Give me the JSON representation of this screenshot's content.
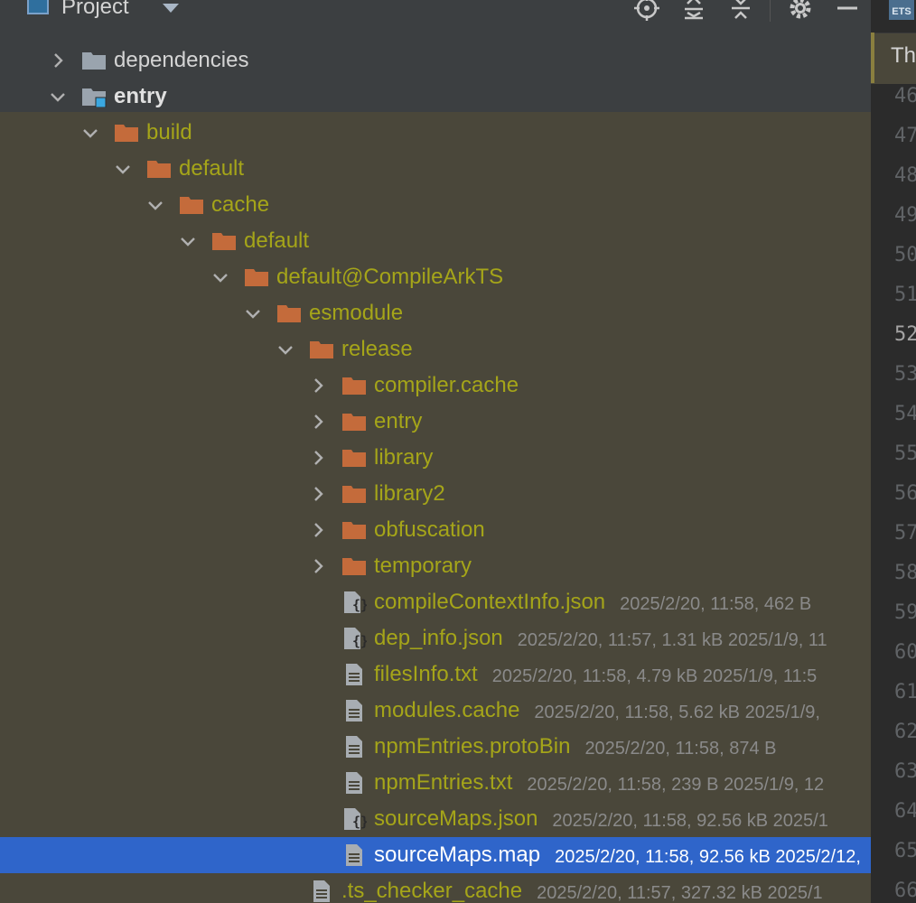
{
  "toolbar": {
    "title": "Project",
    "icons": [
      "locate-icon",
      "expand-all-icon",
      "collapse-all-icon",
      "gear-icon",
      "hide-icon"
    ]
  },
  "tree": {
    "rows": [
      {
        "name": "dependencies",
        "kind": "folder-gray",
        "arrow": "right",
        "meta": "",
        "style": "plain"
      },
      {
        "name": "entry",
        "kind": "module",
        "arrow": "down",
        "meta": "",
        "style": "bold"
      },
      {
        "name": "build",
        "kind": "folder",
        "arrow": "down",
        "meta": ""
      },
      {
        "name": "default",
        "kind": "folder",
        "arrow": "down",
        "meta": ""
      },
      {
        "name": "cache",
        "kind": "folder",
        "arrow": "down",
        "meta": ""
      },
      {
        "name": "default",
        "kind": "folder",
        "arrow": "down",
        "meta": ""
      },
      {
        "name": "default@CompileArkTS",
        "kind": "folder",
        "arrow": "down",
        "meta": ""
      },
      {
        "name": "esmodule",
        "kind": "folder",
        "arrow": "down",
        "meta": ""
      },
      {
        "name": "release",
        "kind": "folder",
        "arrow": "down",
        "meta": ""
      },
      {
        "name": "compiler.cache",
        "kind": "folder",
        "arrow": "right",
        "meta": ""
      },
      {
        "name": "entry",
        "kind": "folder",
        "arrow": "right",
        "meta": ""
      },
      {
        "name": "library",
        "kind": "folder",
        "arrow": "right",
        "meta": ""
      },
      {
        "name": "library2",
        "kind": "folder",
        "arrow": "right",
        "meta": ""
      },
      {
        "name": "obfuscation",
        "kind": "folder",
        "arrow": "right",
        "meta": ""
      },
      {
        "name": "temporary",
        "kind": "folder",
        "arrow": "right",
        "meta": ""
      },
      {
        "name": "compileContextInfo.json",
        "kind": "json",
        "arrow": "",
        "meta": "2025/2/20, 11:58, 462 B"
      },
      {
        "name": "dep_info.json",
        "kind": "json",
        "arrow": "",
        "meta": "2025/2/20, 11:57, 1.31 kB 2025/1/9, 11"
      },
      {
        "name": "filesInfo.txt",
        "kind": "file",
        "arrow": "",
        "meta": "2025/2/20, 11:58, 4.79 kB 2025/1/9, 11:5"
      },
      {
        "name": "modules.cache",
        "kind": "file",
        "arrow": "",
        "meta": "2025/2/20, 11:58, 5.62 kB 2025/1/9,"
      },
      {
        "name": "npmEntries.protoBin",
        "kind": "file",
        "arrow": "",
        "meta": "2025/2/20, 11:58, 874 B"
      },
      {
        "name": "npmEntries.txt",
        "kind": "file",
        "arrow": "",
        "meta": "2025/2/20, 11:58, 239 B 2025/1/9, 12"
      },
      {
        "name": "sourceMaps.json",
        "kind": "json",
        "arrow": "",
        "meta": "2025/2/20, 11:58, 92.56 kB 2025/1"
      },
      {
        "name": "sourceMaps.map",
        "kind": "file",
        "arrow": "",
        "meta": "2025/2/20, 11:58, 92.56 kB 2025/2/12,",
        "selected": true
      },
      {
        "name": ".ts_checker_cache",
        "kind": "file",
        "arrow": "",
        "meta": "2025/2/20, 11:57, 327.32 kB 2025/1"
      }
    ]
  },
  "editor": {
    "tab_badge": "ETS",
    "tab_text": "Th",
    "line_numbers": [
      "46",
      "47",
      "48",
      "49",
      "50",
      "51",
      "52",
      "53",
      "54",
      "55",
      "56",
      "57",
      "58",
      "59",
      "60",
      "61",
      "62",
      "63",
      "64",
      "65",
      "66"
    ],
    "current_line": "52"
  }
}
